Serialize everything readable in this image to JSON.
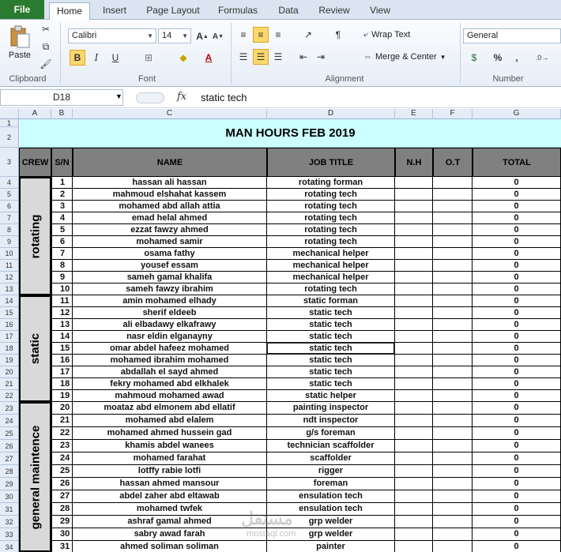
{
  "ribbon": {
    "tabs": [
      "File",
      "Home",
      "Insert",
      "Page Layout",
      "Formulas",
      "Data",
      "Review",
      "View"
    ],
    "active_tab": "Home",
    "clipboard": {
      "paste_label": "Paste",
      "group_label": "Clipboard"
    },
    "font": {
      "name": "Calibri",
      "size": "14",
      "group_label": "Font"
    },
    "alignment": {
      "wrap_text": "Wrap Text",
      "merge_center": "Merge & Center",
      "group_label": "Alignment"
    },
    "number": {
      "format": "General",
      "percent": "%",
      "comma": ",",
      "group_label": "Number"
    }
  },
  "formula_bar": {
    "cell_ref": "D18",
    "fx": "fx",
    "content": "static tech"
  },
  "sheet": {
    "columns": [
      "A",
      "B",
      "C",
      "D",
      "E",
      "F",
      "G"
    ],
    "title": "MAN HOURS FEB 2019",
    "headers": {
      "crew": "CREW",
      "sn": "S/N",
      "name": "NAME",
      "job": "JOB TITLE",
      "nh": "N.H",
      "ot": "O.T",
      "total": "TOTAL"
    },
    "crews": [
      "rotating",
      "static",
      "general maintence"
    ],
    "rows": [
      {
        "sn": "1",
        "name": "hassan ali hassan",
        "job": "rotating forman",
        "total": "0"
      },
      {
        "sn": "2",
        "name": "mahmoud elshahat kassem",
        "job": "rotating tech",
        "total": "0"
      },
      {
        "sn": "3",
        "name": "mohamed abd allah attia",
        "job": "rotating tech",
        "total": "0"
      },
      {
        "sn": "4",
        "name": "emad helal ahmed",
        "job": "rotating tech",
        "total": "0"
      },
      {
        "sn": "5",
        "name": "ezzat fawzy ahmed",
        "job": "rotating tech",
        "total": "0"
      },
      {
        "sn": "6",
        "name": "mohamed samir",
        "job": "rotating tech",
        "total": "0"
      },
      {
        "sn": "7",
        "name": "osama fathy",
        "job": "mechanical helper",
        "total": "0"
      },
      {
        "sn": "8",
        "name": "yousef essam",
        "job": "mechanical helper",
        "total": "0"
      },
      {
        "sn": "9",
        "name": "sameh gamal khalifa",
        "job": "mechanical helper",
        "total": "0"
      },
      {
        "sn": "10",
        "name": "sameh fawzy ibrahim",
        "job": "rotating tech",
        "total": "0"
      },
      {
        "sn": "11",
        "name": "amin mohamed elhady",
        "job": "static forman",
        "total": "0"
      },
      {
        "sn": "12",
        "name": "sherif eldeeb",
        "job": "static tech",
        "total": "0"
      },
      {
        "sn": "13",
        "name": "ali elbadawy elkafrawy",
        "job": "static tech",
        "total": "0"
      },
      {
        "sn": "14",
        "name": "nasr eldin elganaynу",
        "job": "static tech",
        "total": "0"
      },
      {
        "sn": "15",
        "name": "omar abdel hafeez mohamed",
        "job": "static tech",
        "total": "0"
      },
      {
        "sn": "16",
        "name": "mohamed ibrahim mohamed",
        "job": "static tech",
        "total": "0"
      },
      {
        "sn": "17",
        "name": "abdallah el sayd ahmed",
        "job": "static tech",
        "total": "0"
      },
      {
        "sn": "18",
        "name": "fekry mohamed abd elkhalek",
        "job": "static tech",
        "total": "0"
      },
      {
        "sn": "19",
        "name": "mahmoud mohamed awad",
        "job": "static helper",
        "total": "0"
      },
      {
        "sn": "20",
        "name": "moataz abd elmonem abd ellatif",
        "job": "painting inspector",
        "total": "0"
      },
      {
        "sn": "21",
        "name": "mohamed abd elalem",
        "job": "ndt inspector",
        "total": "0"
      },
      {
        "sn": "22",
        "name": "mohamed ahmed hussein gad",
        "job": "g/s foreman",
        "total": "0"
      },
      {
        "sn": "23",
        "name": "khamis abdel wanees",
        "job": "technician scaffolder",
        "total": "0"
      },
      {
        "sn": "24",
        "name": "mohamed farahat",
        "job": "scaffolder",
        "total": "0"
      },
      {
        "sn": "25",
        "name": "lotffy rabie lotfi",
        "job": "rigger",
        "total": "0"
      },
      {
        "sn": "26",
        "name": "hassan ahmed mansour",
        "job": "foreman",
        "total": "0"
      },
      {
        "sn": "27",
        "name": "abdel zaher abd eltawab",
        "job": "ensulation tech",
        "total": "0"
      },
      {
        "sn": "28",
        "name": "mohamed twfek",
        "job": "ensulation tech",
        "total": "0"
      },
      {
        "sn": "29",
        "name": "ashraf gamal ahmed",
        "job": "grp welder",
        "total": "0"
      },
      {
        "sn": "30",
        "name": "sabry awad farah",
        "job": "grp welder",
        "total": "0"
      },
      {
        "sn": "31",
        "name": "ahmed soliman soliman",
        "job": "painter",
        "total": "0"
      }
    ],
    "watermark": "مستقل",
    "watermark_sub": "mostaql.com"
  }
}
